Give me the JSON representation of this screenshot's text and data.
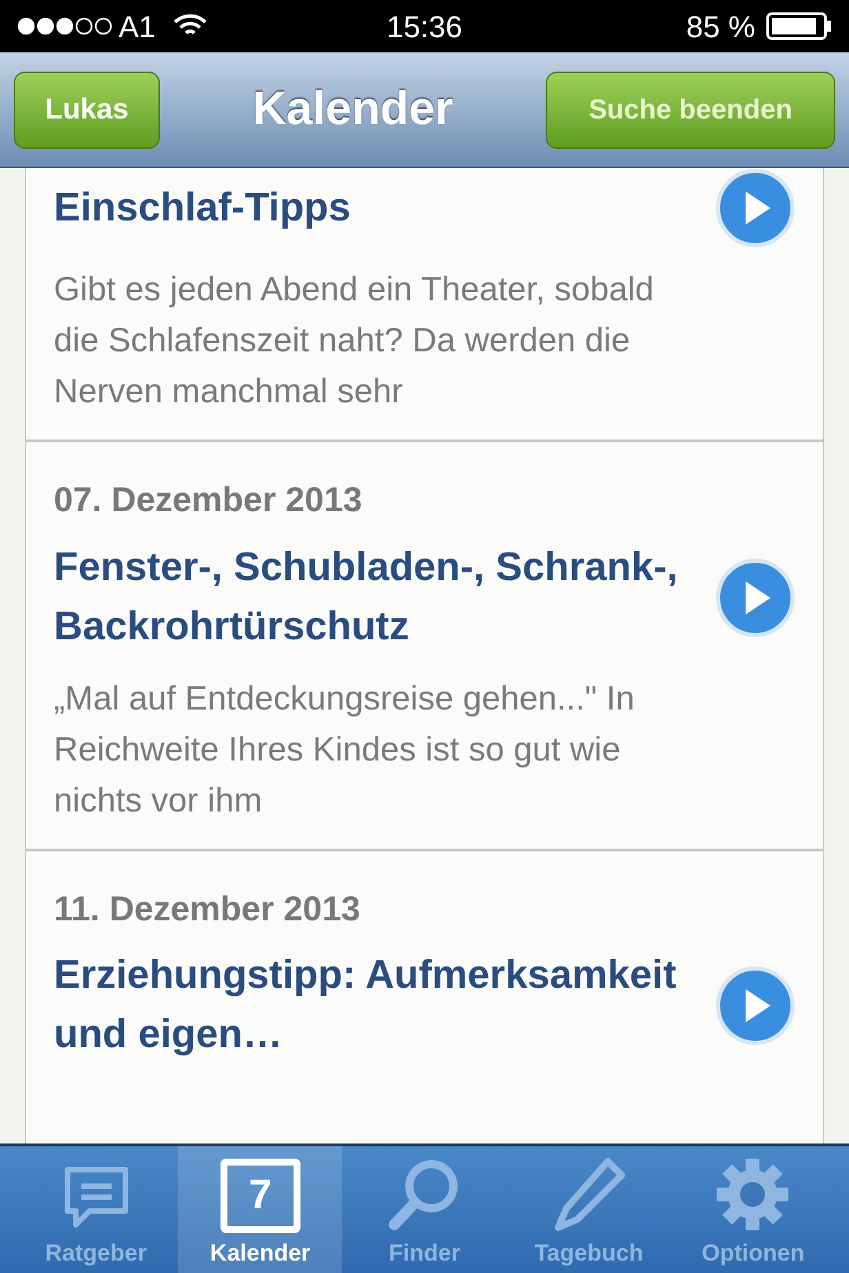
{
  "status_bar": {
    "carrier": "A1",
    "time": "15:36",
    "battery": "85 %"
  },
  "nav_bar": {
    "left_button": "Lukas",
    "title": "Kalender",
    "right_button": "Suche beenden"
  },
  "entries": [
    {
      "title": "Einschlaf-Tipps",
      "description": "Gibt es jeden Abend ein Theater, sobald die Schlafenszeit naht? Da werden die Nerven manchmal sehr"
    },
    {
      "date": "07. Dezember 2013",
      "title": "Fenster-, Schubladen-, Schrank-, Backrohrtürschutz",
      "description": "„Mal auf Entdeckungsreise gehen...\" In Reichweite Ihres Kindes ist so gut wie nichts vor ihm"
    },
    {
      "date": "11. Dezember 2013",
      "title": "Erziehungstipp: Aufmerksamkeit und eigen…"
    }
  ],
  "tab_bar": [
    {
      "label": "Ratgeber",
      "kind": "chat",
      "selected": false
    },
    {
      "label": "Kalender",
      "kind": "calendar",
      "icon_text": "7",
      "selected": true
    },
    {
      "label": "Finder",
      "kind": "search",
      "selected": false
    },
    {
      "label": "Tagebuch",
      "kind": "pencil",
      "selected": false
    },
    {
      "label": "Optionen",
      "kind": "gear",
      "selected": false
    }
  ]
}
